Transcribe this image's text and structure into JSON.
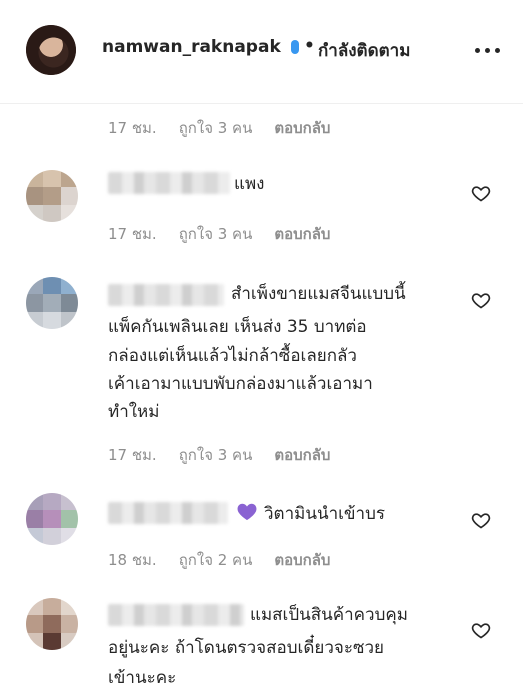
{
  "header": {
    "username": "namwan_raknapak",
    "dot": "•",
    "follow_status": "กำลังติดตาม"
  },
  "comments": [
    {
      "time": "17 ชม.",
      "likes": "ถูกใจ 3 คน",
      "reply": "ตอบกลับ"
    },
    {
      "text": "แพง",
      "time": "17 ชม.",
      "likes": "ถูกใจ 3 คน",
      "reply": "ตอบกลับ"
    },
    {
      "text_lines": [
        "สำเพ็งขายแมสจีนแบบนี้",
        "แพ็คกันเพลินเลย เห็นส่ง 35 บาทต่อ",
        "กล่องแต่เห็นแล้วไม่กล้าซื้อเลยกลัว",
        "เค้าเอามาแบบพับกล่องมาแล้วเอามา",
        "ทำใหม่"
      ],
      "time": "17 ชม.",
      "likes": "ถูกใจ 3 คน",
      "reply": "ตอบกลับ"
    },
    {
      "text": "วิตามินนำเข้าบร",
      "time": "18 ชม.",
      "likes": "ถูกใจ 2 คน",
      "reply": "ตอบกลับ"
    },
    {
      "text_lines": [
        "แมสเป็นสินค้าควบคุม",
        "อยู่นะคะ ถ้าโดนตรวจสอบเดี๋ยวจะซวย",
        "เข้านะคะ"
      ]
    }
  ],
  "colors": {
    "text": "#262626",
    "meta": "#8e8e8e",
    "verified": "#3897f0",
    "purple_heart": "#8a63d2"
  },
  "icons": {
    "more": "more-horizontal-icon",
    "like": "heart-outline-icon",
    "emoji": "purple-heart-emoji"
  }
}
